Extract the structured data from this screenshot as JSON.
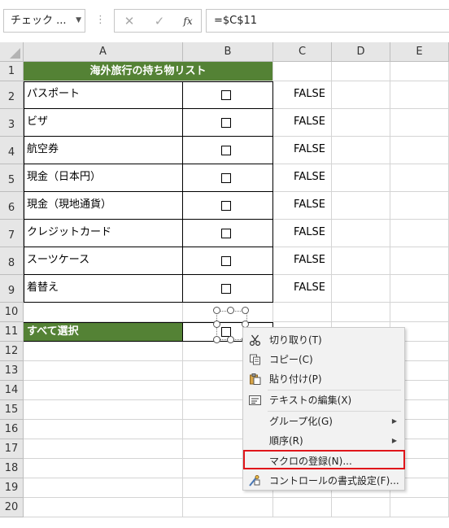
{
  "name_box": {
    "value": "チェック ..."
  },
  "formula_bar": {
    "cancel_glyph": "✕",
    "enter_glyph": "✓",
    "fx_label": "fx",
    "formula": "=$C$11"
  },
  "columns": [
    "A",
    "B",
    "C",
    "D",
    "E"
  ],
  "rows": [
    "1",
    "2",
    "3",
    "4",
    "5",
    "6",
    "7",
    "8",
    "9",
    "10",
    "11",
    "12",
    "13",
    "14",
    "15",
    "16",
    "17",
    "18",
    "19",
    "20"
  ],
  "sheet": {
    "title": "海外旅行の持ち物リスト",
    "items": [
      {
        "label": "パスポート",
        "value": "FALSE"
      },
      {
        "label": "ビザ",
        "value": "FALSE"
      },
      {
        "label": "航空券",
        "value": "FALSE"
      },
      {
        "label": "現金（日本円）",
        "value": "FALSE"
      },
      {
        "label": "現金（現地通貨）",
        "value": "FALSE"
      },
      {
        "label": "クレジットカード",
        "value": "FALSE"
      },
      {
        "label": "スーツケース",
        "value": "FALSE"
      },
      {
        "label": "着替え",
        "value": "FALSE"
      }
    ],
    "select_all_label": "すべて選択",
    "accent_color": "#548235"
  },
  "context_menu": {
    "items": [
      {
        "label": "切り取り(T)",
        "icon": "scissors-icon"
      },
      {
        "label": "コピー(C)",
        "icon": "copy-icon"
      },
      {
        "label": "貼り付け(P)",
        "icon": "paste-icon"
      },
      {
        "label": "テキストの編集(X)",
        "icon": "edit-text-icon"
      },
      {
        "label": "グループ化(G)",
        "icon": "",
        "submenu": true
      },
      {
        "label": "順序(R)",
        "icon": "",
        "submenu": true
      },
      {
        "label": "マクロの登録(N)...",
        "icon": "",
        "highlighted": true
      },
      {
        "label": "コントロールの書式設定(F)...",
        "icon": "format-control-icon"
      }
    ],
    "highlight_color": "#e0161b"
  }
}
